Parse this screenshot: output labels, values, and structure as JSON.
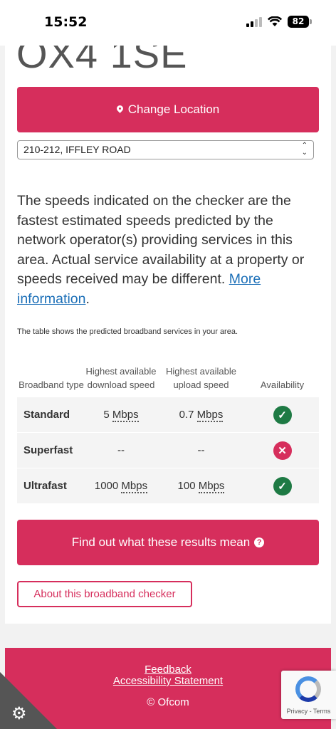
{
  "status_bar": {
    "time": "15:52",
    "battery": "82"
  },
  "postcode": "OX4 1SE",
  "change_location_label": "Change Location",
  "address_select": {
    "selected": "210-212, IFFLEY ROAD"
  },
  "intro": {
    "text": "The speeds indicated on the checker are the fastest estimated speeds predicted by the network operator(s) providing services in this area. Actual service availability at a property or speeds received may be different. ",
    "link": "More information",
    "end": "."
  },
  "table_note": "The table shows the predicted broadband services in your area.",
  "table": {
    "headers": [
      "Broadband type",
      "Highest available download speed",
      "Highest available upload speed",
      "Availability"
    ],
    "rows": [
      {
        "type": "Standard",
        "download": "5",
        "download_unit": "Mbps",
        "upload": "0.7",
        "upload_unit": "Mbps",
        "available": true
      },
      {
        "type": "Superfast",
        "download": "--",
        "upload": "--",
        "available": false
      },
      {
        "type": "Ultrafast",
        "download": "1000",
        "download_unit": "Mbps",
        "upload": "100",
        "upload_unit": "Mbps",
        "available": true
      }
    ]
  },
  "find_out_label": "Find out what these results mean",
  "about_label": "About this broadband checker",
  "footer": {
    "feedback": "Feedback",
    "accessibility": "Accessibility Statement",
    "copyright": "© Ofcom"
  },
  "recaptcha_text": "Privacy - Terms",
  "colors": {
    "brand_pink": "#d62e5c",
    "available_green": "#1e7a44",
    "link_blue": "#1d70b8"
  }
}
